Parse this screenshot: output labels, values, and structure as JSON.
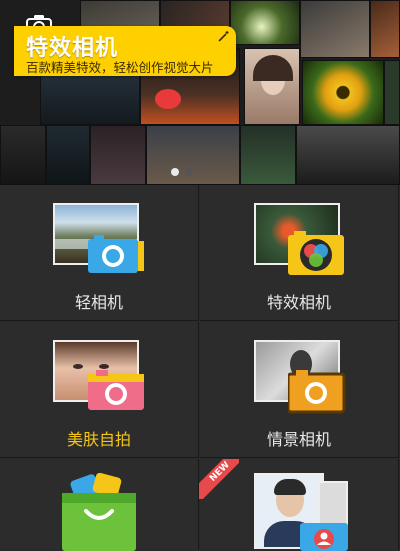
{
  "banner": {
    "promo_title": "特效相机",
    "promo_subtitle": "百款精美特效，轻松创作视觉大片",
    "carousel_pages": 2,
    "carousel_active_index": 0
  },
  "tiles": [
    {
      "label": "轻相机",
      "icon": "light-camera-icon",
      "accent": "#3aa7e6"
    },
    {
      "label": "特效相机",
      "icon": "effects-camera-icon",
      "accent": "#f5c518"
    },
    {
      "label": "美肤自拍",
      "icon": "beauty-selfie-icon",
      "accent": "#f06d8a",
      "label_color": "#f5c518"
    },
    {
      "label": "情景相机",
      "icon": "scene-camera-icon",
      "accent": "#f0a020"
    },
    {
      "label": "",
      "icon": "store-bag-icon",
      "accent": "#6cc23a",
      "badge": "NEW"
    },
    {
      "label": "",
      "icon": "id-photo-icon",
      "accent": "#e64a4a"
    }
  ]
}
